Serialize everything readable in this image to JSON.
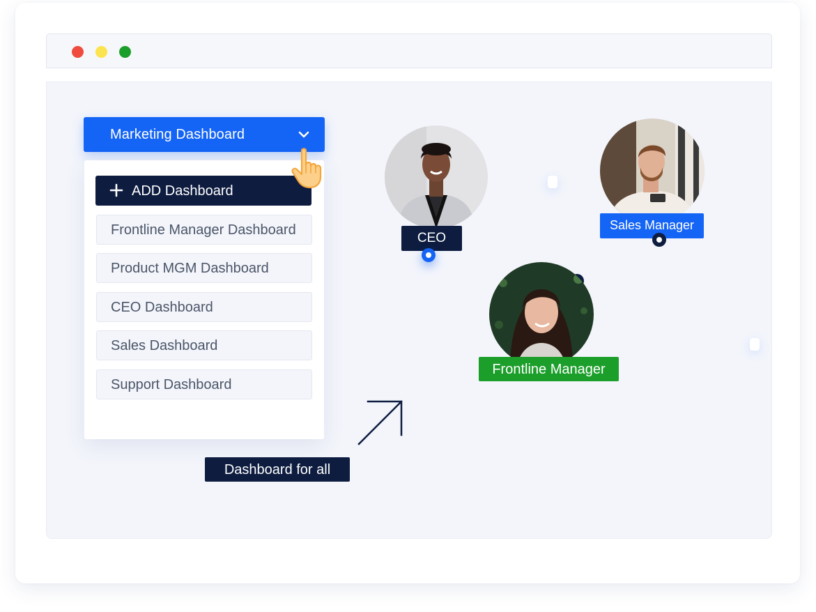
{
  "window": {
    "controls": [
      "close",
      "minimize",
      "maximize"
    ],
    "control_colors": {
      "close": "#ef4b3f",
      "minimize": "#fbe44f",
      "maximize": "#1b9e2a"
    }
  },
  "dashboard_selector": {
    "selected": "Marketing Dashboard",
    "icon": "chevron-down-icon",
    "color": "#1464f5"
  },
  "dropdown": {
    "add_label": "ADD Dashboard",
    "add_icon": "plus-icon",
    "items": [
      "Frontline Manager Dashboard",
      "Product MGM Dashboard",
      "CEO Dashboard",
      "Sales Dashboard",
      "Support Dashboard"
    ]
  },
  "cursor": {
    "icon": "pointer-hand-icon"
  },
  "people": [
    {
      "role": "CEO",
      "tag_color": "#0d1c3f",
      "connector_color": "#1464f5"
    },
    {
      "role": "Sales Manager",
      "tag_color": "#1464f5",
      "connector_color": "#0d1c3f"
    },
    {
      "role": "Frontline Manager",
      "tag_color": "#1b9e2a",
      "connector_color": "#0d1c3f"
    }
  ],
  "annotation": {
    "caption": "Dashboard for all",
    "icon": "arrow-up-right-icon"
  },
  "colors": {
    "navy": "#0d1c3f",
    "brand_blue": "#1464f5",
    "green": "#1b9e2a",
    "stage_bg": "#f3f5fb"
  }
}
